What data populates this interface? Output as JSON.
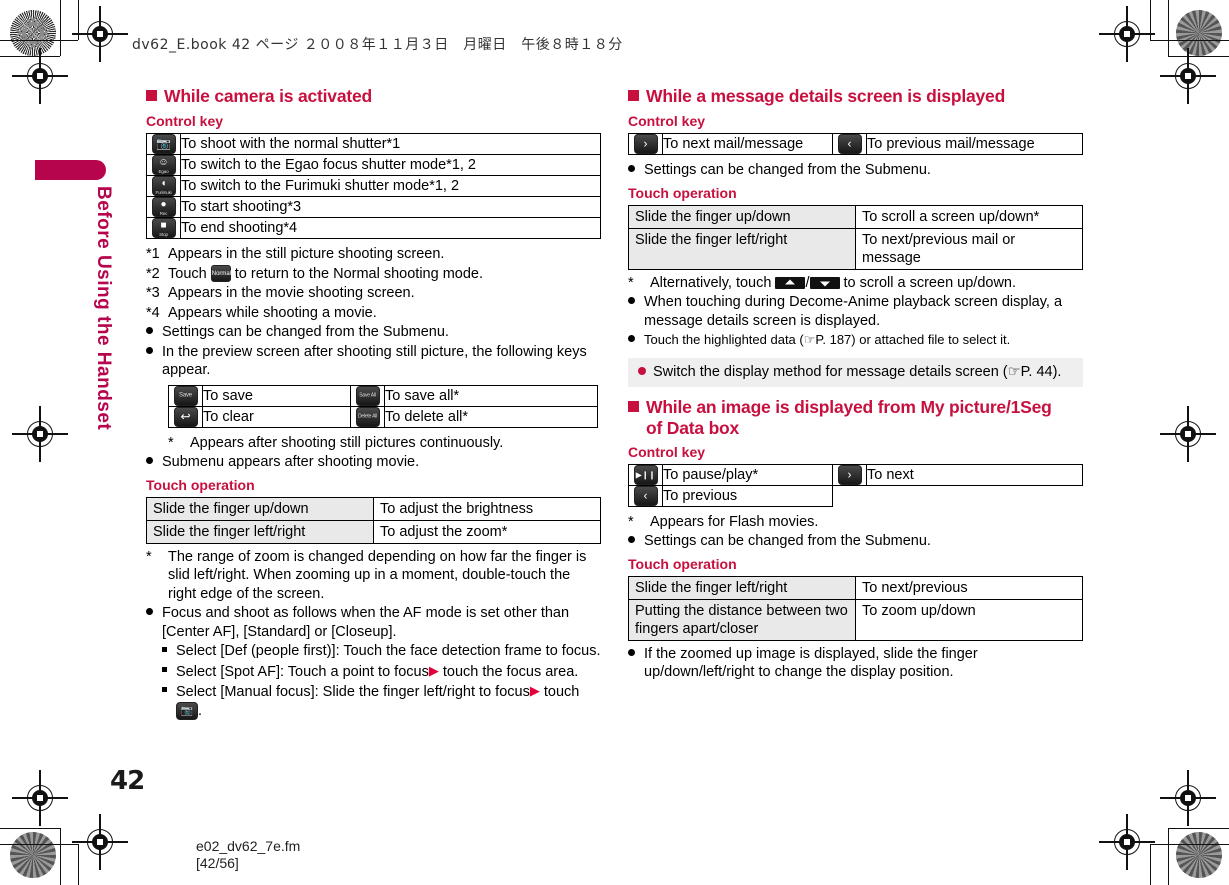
{
  "header_meta": "dv62_E.book  42 ページ  ２００８年１１月３日　月曜日　午後８時１８分",
  "side_tab": "Before Using the Handset",
  "page_number": "42",
  "footer": {
    "file": "e02_dv62_7e.fm",
    "pages": "[42/56]"
  },
  "colors": {
    "accent": "#c8103f",
    "tab": "#b6054c",
    "table_gray": "#e9e9e9",
    "note_bg": "#efefef"
  },
  "left_column": {
    "section_title": "While camera is activated",
    "control_key_label": "Control key",
    "control_key_rows": [
      {
        "icon": "camera-shutter-key",
        "icon_label": "",
        "text": "To shoot with the normal shutter*1"
      },
      {
        "icon": "egao-shutter-key",
        "icon_label": "Egao",
        "text": "To switch to the Egao focus shutter mode*1, 2"
      },
      {
        "icon": "furimuki-shutter-key",
        "icon_label": "Furimuki",
        "text": "To switch to the Furimuki shutter mode*1, 2"
      },
      {
        "icon": "rec-key",
        "icon_label": "Rec",
        "text": "To start shooting*3"
      },
      {
        "icon": "stop-key",
        "icon_label": "Stop",
        "text": "To end shooting*4"
      }
    ],
    "footnotes": [
      {
        "mark": "*1",
        "text": "Appears in the still picture shooting screen."
      },
      {
        "mark": "*2",
        "text_before": "Touch ",
        "inline_icon": "normal-key",
        "inline_icon_label": "Normal",
        "text_after": " to return to the Normal shooting mode."
      },
      {
        "mark": "*3",
        "text": "Appears in the movie shooting screen."
      },
      {
        "mark": "*4",
        "text": "Appears while shooting a movie."
      }
    ],
    "bullets_1": [
      "Settings can be changed from the Submenu.",
      "In the preview screen after shooting still picture, the following keys appear."
    ],
    "preview_key_rows": [
      {
        "icon": "save-key",
        "icon_label": "Save",
        "text": "To save",
        "icon2": "save-all-key",
        "icon2_label": "Save All",
        "text2": "To save all*"
      },
      {
        "icon": "clear-key",
        "icon_label": "",
        "text": "To clear",
        "icon2": "delete-all-key",
        "icon2_label": "Delete All",
        "text2": "To delete all*"
      }
    ],
    "preview_footnote": {
      "mark": "*",
      "text": "Appears after shooting still pictures continuously."
    },
    "bullets_2": [
      "Submenu appears after shooting movie."
    ],
    "touch_operation_label": "Touch operation",
    "touch_rows": [
      {
        "action": "Slide the finger up/down",
        "result": "To adjust the brightness"
      },
      {
        "action": "Slide the finger left/right",
        "result": "To adjust the zoom*"
      }
    ],
    "touch_footnote": {
      "mark": "*",
      "text": "The range of zoom is changed depending on how far the finger is slid left/right. When zooming up in a moment, double-touch the right edge of the screen."
    },
    "af_bullet": "Focus and shoot as follows when the AF mode is set other than [Center AF], [Standard] or [Closeup].",
    "af_items": [
      {
        "text": "Select [Def (people first)]: Touch the face detection frame to focus."
      },
      {
        "before": "Select [Spot AF]: Touch a point to focus",
        "after": "touch the focus area."
      },
      {
        "before": "Select [Manual focus]: Slide the finger left/right to focus",
        "after": "touch",
        "trailing_icon": "camera-shutter-key",
        "end": "."
      }
    ]
  },
  "right_column": {
    "section_title_1": "While a message details screen is displayed",
    "control_key_label_1": "Control key",
    "control_key_rows_1": [
      {
        "icon": "next-arrow-key",
        "text": "To next mail/message",
        "icon2": "previous-arrow-key",
        "text2": "To previous mail/message"
      }
    ],
    "bullets_1": [
      "Settings can be changed from the Submenu."
    ],
    "touch_operation_label_1": "Touch operation",
    "touch_rows_1": [
      {
        "action": "Slide the finger up/down",
        "result": "To scroll a screen up/down*"
      },
      {
        "action": "Slide the finger left/right",
        "result": "To next/previous mail or message"
      }
    ],
    "footnote_1": {
      "mark": "*",
      "before": "Alternatively, touch ",
      "mid": "/",
      "after": " to scroll a screen up/down."
    },
    "bullets_2": [
      "When touching during Decome-Anime playback screen display, a message details screen is displayed.",
      "Touch the highlighted data (☞P. 187) or attached file to select it."
    ],
    "note_band": "Switch the display method for message details screen (☞P. 44).",
    "section_title_2": "While an image is displayed from My picture/1Seg",
    "section_title_2b": "of Data box",
    "control_key_label_2": "Control key",
    "control_key_rows_2": [
      {
        "icon": "pause-play-key",
        "text": "To pause/play*",
        "icon2": "next-arrow-key",
        "text2": "To next"
      },
      {
        "icon": "previous-arrow-key",
        "text": "To previous",
        "icon2": null,
        "text2": null
      }
    ],
    "footnote_2": {
      "mark": "*",
      "text": "Appears for Flash movies."
    },
    "bullets_3": [
      "Settings can be changed from the Submenu."
    ],
    "touch_operation_label_2": "Touch operation",
    "touch_rows_2": [
      {
        "action": "Slide the finger left/right",
        "result": "To next/previous"
      },
      {
        "action": "Putting the distance between two fingers apart/closer",
        "result": "To zoom up/down"
      }
    ],
    "bullets_4": [
      "If the zoomed up image is displayed, slide the finger up/down/left/right to change the display position."
    ]
  }
}
